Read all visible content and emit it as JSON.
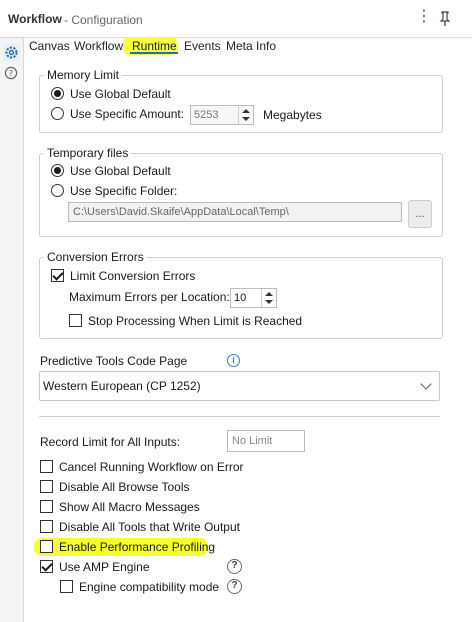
{
  "header": {
    "title": "Workflow",
    "subtitle": "- Configuration",
    "menu_icon": "⋮"
  },
  "tabs": [
    {
      "label": "Canvas"
    },
    {
      "label": "Workflow"
    },
    {
      "label": "Runtime",
      "active": true
    },
    {
      "label": "Events"
    },
    {
      "label": "Meta Info"
    }
  ],
  "memory": {
    "legend": "Memory Limit",
    "option_default": "Use Global Default",
    "option_specific": "Use Specific Amount:",
    "amount_value": "5253",
    "unit": "Megabytes",
    "selected": "default"
  },
  "temp_files": {
    "legend": "Temporary files",
    "option_default": "Use Global Default",
    "option_specific": "Use Specific Folder:",
    "folder_path": "C:\\Users\\David.Skaife\\AppData\\Local\\Temp\\",
    "browse_label": "...",
    "selected": "default"
  },
  "conversion": {
    "legend": "Conversion Errors",
    "limit_label": "Limit Conversion Errors",
    "limit_checked": true,
    "max_label": "Maximum Errors per Location:",
    "max_value": "10",
    "stop_label": "Stop Processing When Limit is Reached",
    "stop_checked": false
  },
  "code_page": {
    "label": "Predictive Tools Code Page",
    "selected": "Western European (CP 1252)",
    "info_icon": "i"
  },
  "record_limit": {
    "label": "Record Limit for All Inputs:",
    "placeholder": "No Limit"
  },
  "options": {
    "cancel_on_error": {
      "label": "Cancel Running Workflow on Error",
      "checked": false
    },
    "disable_browse": {
      "label": "Disable All Browse Tools",
      "checked": false
    },
    "show_macro": {
      "label": "Show All Macro Messages",
      "checked": false
    },
    "disable_output": {
      "label": "Disable All Tools that Write Output",
      "checked": false
    },
    "profiling": {
      "label": "Enable Performance Profiling",
      "checked": false
    },
    "amp": {
      "label": "Use AMP Engine",
      "checked": true
    },
    "compat": {
      "label": "Engine compatibility mode",
      "checked": false
    }
  },
  "help_glyph": "?",
  "colors": {
    "accent": "#1c6dbf",
    "highlight": "#f7ff2a"
  }
}
